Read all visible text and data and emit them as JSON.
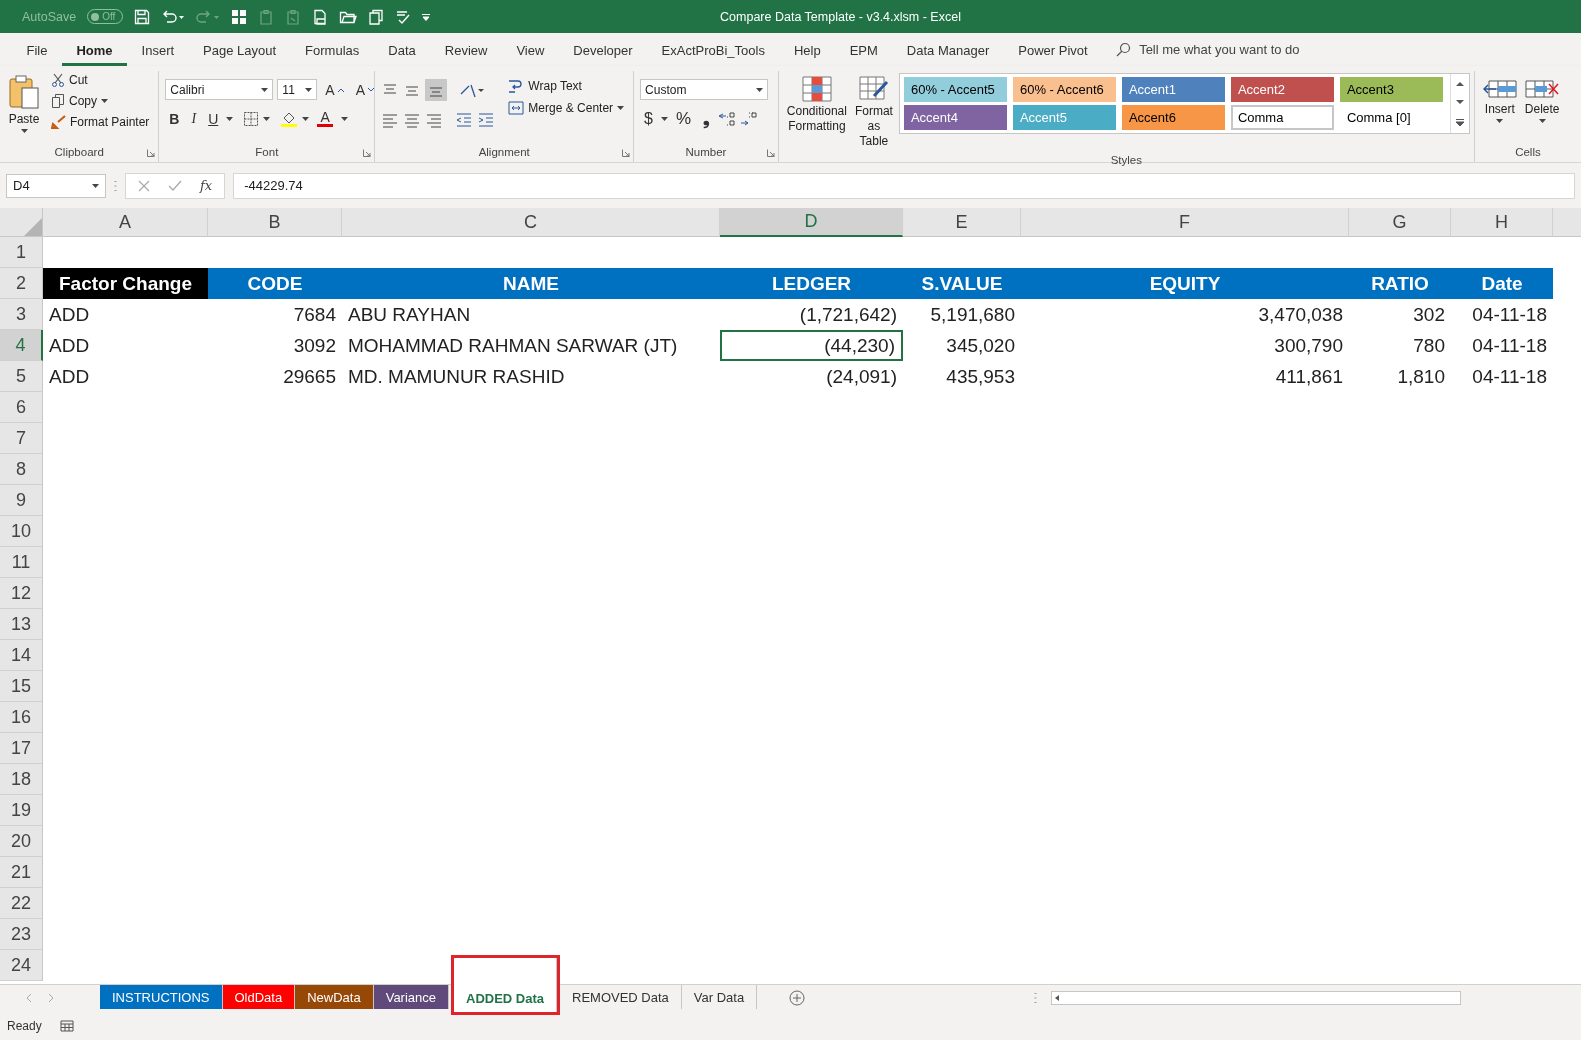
{
  "window": {
    "title": "Compare Data Template - v3.4.xlsm  -  Excel",
    "autosave": {
      "label": "AutoSave",
      "state": "Off",
      "on": false
    }
  },
  "menu_tabs": [
    {
      "label": "File",
      "selected": false
    },
    {
      "label": "Home",
      "selected": true
    },
    {
      "label": "Insert",
      "selected": false
    },
    {
      "label": "Page Layout",
      "selected": false
    },
    {
      "label": "Formulas",
      "selected": false
    },
    {
      "label": "Data",
      "selected": false
    },
    {
      "label": "Review",
      "selected": false
    },
    {
      "label": "View",
      "selected": false
    },
    {
      "label": "Developer",
      "selected": false
    },
    {
      "label": "ExActProBi_Tools",
      "selected": false
    },
    {
      "label": "Help",
      "selected": false
    },
    {
      "label": "EPM",
      "selected": false
    },
    {
      "label": "Data Manager",
      "selected": false
    },
    {
      "label": "Power Pivot",
      "selected": false
    }
  ],
  "tell_me": {
    "placeholder": "Tell me what you want to do"
  },
  "ribbon": {
    "clipboard": {
      "label": "Clipboard",
      "paste": "Paste",
      "cut": "Cut",
      "copy": "Copy",
      "format_painter": "Format Painter"
    },
    "font": {
      "label": "Font",
      "font_name": "Calibri",
      "font_size": "11",
      "grow": "A",
      "shrink": "A",
      "bold": "B",
      "italic": "I",
      "underline": "U",
      "font_color": "A"
    },
    "alignment": {
      "label": "Alignment",
      "wrap_text": "Wrap Text",
      "merge_center": "Merge & Center"
    },
    "number": {
      "label": "Number",
      "format": "Custom",
      "currency": "$",
      "percent": "%",
      "comma": "❟"
    },
    "styles": {
      "label": "Styles",
      "conditional_formatting": "Conditional Formatting",
      "format_as_table": "Format as Table",
      "cell_styles": [
        {
          "label": "60% - Accent5",
          "color": "#92cddc",
          "selected": false
        },
        {
          "label": "60% - Accent6",
          "color": "#fabf8f",
          "selected": false
        },
        {
          "label": "Accent1",
          "color": "#4f81bd",
          "selected": false
        },
        {
          "label": "Accent2",
          "color": "#c0504d",
          "selected": false
        },
        {
          "label": "Accent3",
          "color": "#9bbb59",
          "selected": false
        },
        {
          "label": "Accent4",
          "color": "#8064a2",
          "selected": false
        },
        {
          "label": "Accent5",
          "color": "#4bacc6",
          "selected": false
        },
        {
          "label": "Accent6",
          "color": "#f79646",
          "selected": false
        },
        {
          "label": "Comma",
          "color": "#ffffff",
          "selected": true
        },
        {
          "label": "Comma [0]",
          "color": "#ffffff",
          "selected": false
        }
      ]
    },
    "cells": {
      "label": "Cells",
      "insert": "Insert",
      "delete": "Delete"
    }
  },
  "formula_bar": {
    "name_box": "D4",
    "function_label": "fx",
    "formula": "-44229.74"
  },
  "sheet": {
    "columns": [
      {
        "label": "A",
        "selected": false
      },
      {
        "label": "B",
        "selected": false
      },
      {
        "label": "C",
        "selected": false
      },
      {
        "label": "D",
        "selected": true
      },
      {
        "label": "E",
        "selected": false
      },
      {
        "label": "F",
        "selected": false
      },
      {
        "label": "G",
        "selected": false
      },
      {
        "label": "H",
        "selected": false
      }
    ],
    "rows": [
      {
        "label": "1",
        "selected": false,
        "kind": "empty"
      },
      {
        "label": "2",
        "selected": false,
        "kind": "header",
        "cells": [
          {
            "text": "Factor Change",
            "color": "#000000"
          },
          {
            "text": "CODE",
            "color": "#0070c0"
          },
          {
            "text": "NAME",
            "color": "#0070c0"
          },
          {
            "text": "LEDGER",
            "color": "#0070c0"
          },
          {
            "text": "S.VALUE",
            "color": "#0070c0"
          },
          {
            "text": "EQUITY",
            "color": "#0070c0"
          },
          {
            "text": "RATIO",
            "color": "#0070c0"
          },
          {
            "text": "Date",
            "color": "#0070c0"
          }
        ]
      },
      {
        "label": "3",
        "selected": false,
        "kind": "data",
        "cells": [
          {
            "text": "ADD",
            "selected": false
          },
          {
            "text": "7684",
            "selected": false
          },
          {
            "text": "ABU RAYHAN",
            "selected": false
          },
          {
            "text": "(1,721,642)",
            "selected": false
          },
          {
            "text": "5,191,680",
            "selected": false
          },
          {
            "text": "3,470,038",
            "selected": false
          },
          {
            "text": "302",
            "selected": false
          },
          {
            "text": "04-11-18",
            "selected": false
          }
        ]
      },
      {
        "label": "4",
        "selected": true,
        "kind": "data",
        "cells": [
          {
            "text": "ADD",
            "selected": false
          },
          {
            "text": "3092",
            "selected": false
          },
          {
            "text": "MOHAMMAD RAHMAN SARWAR (JT)",
            "selected": false
          },
          {
            "text": "(44,230)",
            "selected": true
          },
          {
            "text": "345,020",
            "selected": false
          },
          {
            "text": "300,790",
            "selected": false
          },
          {
            "text": "780",
            "selected": false
          },
          {
            "text": "04-11-18",
            "selected": false
          }
        ]
      },
      {
        "label": "5",
        "selected": false,
        "kind": "data",
        "cells": [
          {
            "text": "ADD",
            "selected": false
          },
          {
            "text": "29665",
            "selected": false
          },
          {
            "text": "MD. MAMUNUR RASHID",
            "selected": false
          },
          {
            "text": "(24,091)",
            "selected": false
          },
          {
            "text": "435,953",
            "selected": false
          },
          {
            "text": "411,861",
            "selected": false
          },
          {
            "text": "1,810",
            "selected": false
          },
          {
            "text": "04-11-18",
            "selected": false
          }
        ]
      },
      {
        "label": "6",
        "selected": false,
        "kind": "empty"
      },
      {
        "label": "7",
        "selected": false,
        "kind": "empty"
      },
      {
        "label": "8",
        "selected": false,
        "kind": "empty"
      },
      {
        "label": "9",
        "selected": false,
        "kind": "empty"
      },
      {
        "label": "10",
        "selected": false,
        "kind": "empty"
      },
      {
        "label": "11",
        "selected": false,
        "kind": "empty"
      },
      {
        "label": "12",
        "selected": false,
        "kind": "empty"
      },
      {
        "label": "13",
        "selected": false,
        "kind": "empty"
      },
      {
        "label": "14",
        "selected": false,
        "kind": "empty"
      },
      {
        "label": "15",
        "selected": false,
        "kind": "empty"
      },
      {
        "label": "16",
        "selected": false,
        "kind": "empty"
      },
      {
        "label": "17",
        "selected": false,
        "kind": "empty"
      },
      {
        "label": "18",
        "selected": false,
        "kind": "empty"
      },
      {
        "label": "19",
        "selected": false,
        "kind": "empty"
      },
      {
        "label": "20",
        "selected": false,
        "kind": "empty"
      },
      {
        "label": "21",
        "selected": false,
        "kind": "empty"
      },
      {
        "label": "22",
        "selected": false,
        "kind": "empty"
      },
      {
        "label": "23",
        "selected": false,
        "kind": "empty"
      },
      {
        "label": "24",
        "selected": false,
        "kind": "empty"
      }
    ]
  },
  "sheet_tabs": [
    {
      "label": "INSTRUCTIONS",
      "color": "#0070c0",
      "selected": false,
      "highlighted": false
    },
    {
      "label": "OldData",
      "color": "#ff0000",
      "selected": false,
      "highlighted": false
    },
    {
      "label": "NewData",
      "color": "#974706",
      "selected": false,
      "highlighted": false
    },
    {
      "label": "Variance",
      "color": "#604a7b",
      "selected": false,
      "highlighted": false
    },
    {
      "label": "ADDED Data",
      "selected": true,
      "highlighted": true
    },
    {
      "label": "REMOVED Data",
      "selected": false,
      "highlighted": false
    },
    {
      "label": "Var Data",
      "selected": false,
      "highlighted": false
    }
  ],
  "status_bar": {
    "text": "Ready"
  }
}
